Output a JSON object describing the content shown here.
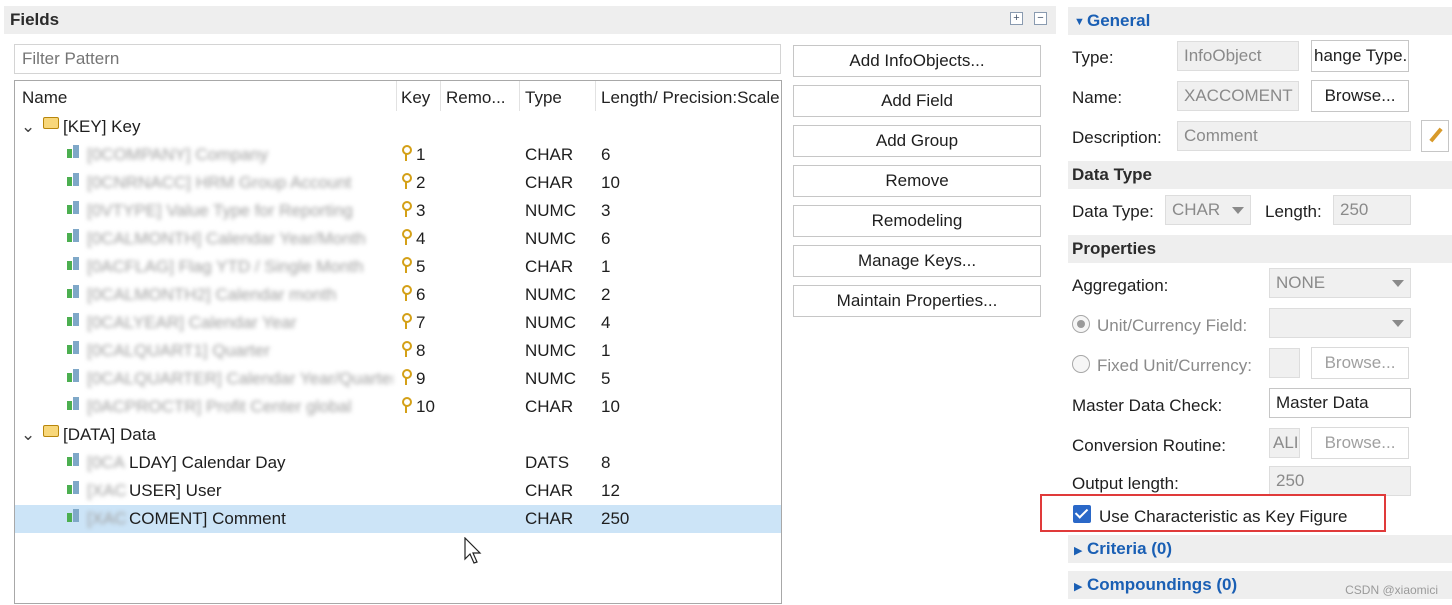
{
  "fields_panel": {
    "title": "Fields",
    "filter_placeholder": "Filter Pattern",
    "columns": [
      "Name",
      "Key",
      "Remo...",
      "Type",
      "Length/ Precision:Scale"
    ],
    "key_group": "[KEY] Key",
    "key_rows": [
      {
        "name": "[0COMPANY] Company",
        "key": "1",
        "type": "CHAR",
        "length": "6"
      },
      {
        "name": "[0CNRNACC] HRM Group Account",
        "key": "2",
        "type": "CHAR",
        "length": "10"
      },
      {
        "name": "[0VTYPE] Value Type for Reporting",
        "key": "3",
        "type": "NUMC",
        "length": "3"
      },
      {
        "name": "[0CALMONTH] Calendar Year/Month",
        "key": "4",
        "type": "NUMC",
        "length": "6"
      },
      {
        "name": "[0ACFLAG] Flag YTD / Single Month",
        "key": "5",
        "type": "CHAR",
        "length": "1"
      },
      {
        "name": "[0CALMONTH2] Calendar month",
        "key": "6",
        "type": "NUMC",
        "length": "2"
      },
      {
        "name": "[0CALYEAR] Calendar Year",
        "key": "7",
        "type": "NUMC",
        "length": "4"
      },
      {
        "name": "[0CALQUART1] Quarter",
        "key": "8",
        "type": "NUMC",
        "length": "1"
      },
      {
        "name": "[0CALQUARTER] Calendar Year/Quarter",
        "key": "9",
        "type": "NUMC",
        "length": "5"
      },
      {
        "name": "[0ACPROCTR] Profit Center global",
        "key": "10",
        "type": "CHAR",
        "length": "10"
      }
    ],
    "data_group": "[DATA] Data",
    "data_rows": [
      {
        "name_hidden": "[0CA",
        "name_visible": "LDAY] Calendar Day",
        "type": "DATS",
        "length": "8"
      },
      {
        "name_hidden": "[XAC",
        "name_visible": "USER] User",
        "type": "CHAR",
        "length": "12"
      },
      {
        "name_hidden": "[XAC",
        "name_visible": "COMENT] Comment",
        "type": "CHAR",
        "length": "250"
      }
    ]
  },
  "actions": [
    "Add InfoObjects...",
    "Add Field",
    "Add Group",
    "Remove",
    "Remodeling",
    "Manage Keys...",
    "Maintain Properties..."
  ],
  "general": {
    "title": "General",
    "type_label": "Type:",
    "type_value": "InfoObject",
    "change_type_btn": "hange Type.",
    "name_label": "Name:",
    "name_value": "XACCOMENT",
    "browse_btn": "Browse...",
    "desc_label": "Description:",
    "desc_value": "Comment"
  },
  "data_type": {
    "title": "Data Type",
    "type_label": "Data Type:",
    "type_value": "CHAR",
    "length_label": "Length:",
    "length_value": "250"
  },
  "properties": {
    "title": "Properties",
    "aggregation_label": "Aggregation:",
    "aggregation_value": "NONE",
    "unit_field_label": "Unit/Currency Field:",
    "fixed_unit_label": "Fixed Unit/Currency:",
    "browse_btn": "Browse...",
    "master_check_label": "Master Data Check:",
    "master_check_value": "Master Data",
    "conversion_label": "Conversion Routine:",
    "conversion_value": "ALI",
    "output_label": "Output length:",
    "output_value": "250",
    "use_char_label": "Use Characteristic as Key Figure"
  },
  "criteria": "Criteria (0)",
  "compoundings": "Compoundings (0)",
  "watermark": "CSDN @xiaomici"
}
